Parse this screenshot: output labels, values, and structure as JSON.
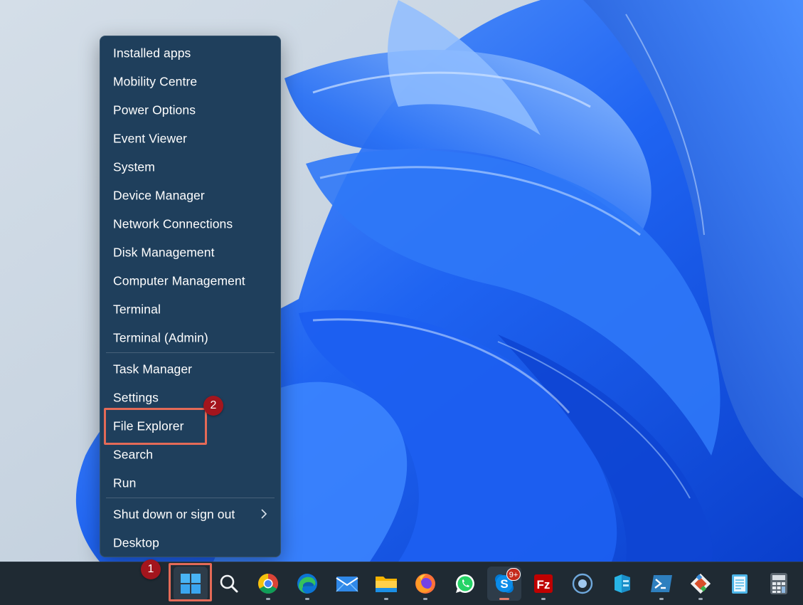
{
  "menu": {
    "items": [
      {
        "label": "Installed apps"
      },
      {
        "label": "Mobility Centre"
      },
      {
        "label": "Power Options"
      },
      {
        "label": "Event Viewer"
      },
      {
        "label": "System"
      },
      {
        "label": "Device Manager"
      },
      {
        "label": "Network Connections"
      },
      {
        "label": "Disk Management"
      },
      {
        "label": "Computer Management"
      },
      {
        "label": "Terminal"
      },
      {
        "label": "Terminal (Admin)"
      },
      {
        "label": "Task Manager"
      },
      {
        "label": "Settings"
      },
      {
        "label": "File Explorer",
        "highlighted": true
      },
      {
        "label": "Search"
      },
      {
        "label": "Run"
      },
      {
        "label": "Shut down or sign out",
        "has_submenu": true
      },
      {
        "label": "Desktop"
      }
    ]
  },
  "annotations": {
    "step1": "1",
    "step2": "2",
    "highlight_color": "#e46a57",
    "badge_color": "#a3151d"
  },
  "taskbar": {
    "buttons": [
      {
        "icon": "windows-start-icon",
        "active": true
      },
      {
        "icon": "search-icon"
      },
      {
        "icon": "chrome-icon"
      },
      {
        "icon": "edge-icon"
      },
      {
        "icon": "mail-icon"
      },
      {
        "icon": "file-explorer-icon"
      },
      {
        "icon": "firefox-icon"
      },
      {
        "icon": "whatsapp-icon"
      },
      {
        "icon": "skype-icon",
        "badge": "9+"
      },
      {
        "icon": "filezilla-icon"
      },
      {
        "icon": "cortana-icon"
      },
      {
        "icon": "azure-data-studio-icon"
      },
      {
        "icon": "powershell-icon"
      },
      {
        "icon": "git-icon"
      },
      {
        "icon": "notepad-icon"
      },
      {
        "icon": "calculator-icon"
      }
    ],
    "skype_badge": "9+"
  },
  "colors": {
    "menu_bg": "#1f3f5c",
    "taskbar_bg": "#1f2a33",
    "wallpaper_blue": "#1a5df0"
  }
}
